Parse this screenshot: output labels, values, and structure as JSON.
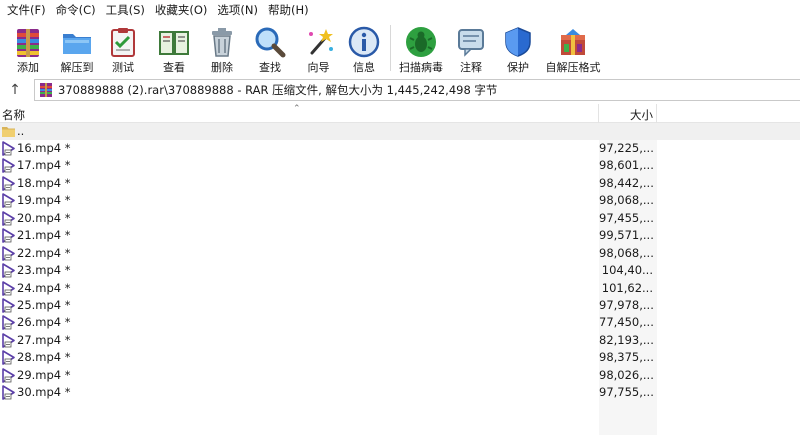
{
  "menu": [
    "文件(F)",
    "命令(C)",
    "工具(S)",
    "收藏夹(O)",
    "选项(N)",
    "帮助(H)"
  ],
  "toolbar": [
    {
      "label": "添加",
      "icon": "add-archive-icon",
      "name": "add"
    },
    {
      "label": "解压到",
      "icon": "extract-to-folder-icon",
      "name": "extract-to"
    },
    {
      "label": "测试",
      "icon": "test-clipboard-icon",
      "name": "test"
    },
    {
      "label": "查看",
      "icon": "view-book-icon",
      "name": "view"
    },
    {
      "label": "删除",
      "icon": "trash-bin-icon",
      "name": "delete"
    },
    {
      "label": "查找",
      "icon": "magnifier-icon",
      "name": "find"
    },
    {
      "label": "向导",
      "icon": "magic-wand-icon",
      "name": "wizard"
    },
    {
      "label": "信息",
      "icon": "info-icon",
      "name": "info"
    },
    {
      "label": "扫描病毒",
      "icon": "virus-scan-icon",
      "name": "virus-scan"
    },
    {
      "label": "注释",
      "icon": "comment-icon",
      "name": "comment"
    },
    {
      "label": "保护",
      "icon": "shield-icon",
      "name": "protect"
    },
    {
      "label": "自解压格式",
      "icon": "sfx-box-icon",
      "name": "sfx"
    }
  ],
  "address": {
    "path": "370889888 (2).rar\\370889888 - RAR 压缩文件, 解包大小为 1,445,242,498 字节"
  },
  "columns": {
    "name": "名称",
    "size": "大小"
  },
  "parent_row": "..",
  "files": [
    {
      "name": "16.mp4 *",
      "size": "97,225,..."
    },
    {
      "name": "17.mp4 *",
      "size": "98,601,..."
    },
    {
      "name": "18.mp4 *",
      "size": "98,442,..."
    },
    {
      "name": "19.mp4 *",
      "size": "98,068,..."
    },
    {
      "name": "20.mp4 *",
      "size": "97,455,..."
    },
    {
      "name": "21.mp4 *",
      "size": "99,571,..."
    },
    {
      "name": "22.mp4 *",
      "size": "98,068,..."
    },
    {
      "name": "23.mp4 *",
      "size": "104,40..."
    },
    {
      "name": "24.mp4 *",
      "size": "101,62..."
    },
    {
      "name": "25.mp4 *",
      "size": "97,978,..."
    },
    {
      "name": "26.mp4 *",
      "size": "77,450,..."
    },
    {
      "name": "27.mp4 *",
      "size": "82,193,..."
    },
    {
      "name": "28.mp4 *",
      "size": "98,375,..."
    },
    {
      "name": "29.mp4 *",
      "size": "98,026,..."
    },
    {
      "name": "30.mp4 *",
      "size": "97,755,..."
    }
  ],
  "colors": {
    "video_icon": "#5b3fa8",
    "folder": "#d9b45a"
  }
}
